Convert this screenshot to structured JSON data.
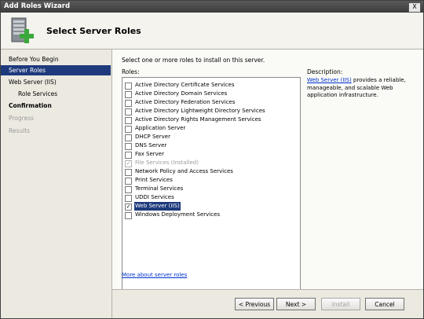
{
  "window": {
    "title": "Add Roles Wizard",
    "close_glyph": "X"
  },
  "header": {
    "title": "Select Server Roles",
    "icon": "server-add-icon"
  },
  "nav": [
    {
      "label": "Before You Begin",
      "state": "normal"
    },
    {
      "label": "Server Roles",
      "state": "active"
    },
    {
      "label": "Web Server (IIS)",
      "state": "normal"
    },
    {
      "label": "Role Services",
      "state": "sub"
    },
    {
      "label": "Confirmation",
      "state": "bold"
    },
    {
      "label": "Progress",
      "state": "disabled"
    },
    {
      "label": "Results",
      "state": "disabled"
    }
  ],
  "main": {
    "instruction": "Select one or more roles to install on this server.",
    "roles_label": "Roles:",
    "roles": [
      {
        "label": "Active Directory Certificate Services",
        "checked": false,
        "disabled": false,
        "selected": false
      },
      {
        "label": "Active Directory Domain Services",
        "checked": false,
        "disabled": false,
        "selected": false
      },
      {
        "label": "Active Directory Federation Services",
        "checked": false,
        "disabled": false,
        "selected": false
      },
      {
        "label": "Active Directory Lightweight Directory Services",
        "checked": false,
        "disabled": false,
        "selected": false
      },
      {
        "label": "Active Directory Rights Management Services",
        "checked": false,
        "disabled": false,
        "selected": false
      },
      {
        "label": "Application Server",
        "checked": false,
        "disabled": false,
        "selected": false
      },
      {
        "label": "DHCP Server",
        "checked": false,
        "disabled": false,
        "selected": false
      },
      {
        "label": "DNS Server",
        "checked": false,
        "disabled": false,
        "selected": false
      },
      {
        "label": "Fax Server",
        "checked": false,
        "disabled": false,
        "selected": false
      },
      {
        "label": "File Services  (Installed)",
        "checked": true,
        "disabled": true,
        "selected": false
      },
      {
        "label": "Network Policy and Access Services",
        "checked": false,
        "disabled": false,
        "selected": false
      },
      {
        "label": "Print Services",
        "checked": false,
        "disabled": false,
        "selected": false
      },
      {
        "label": "Terminal Services",
        "checked": false,
        "disabled": false,
        "selected": false
      },
      {
        "label": "UDDI Services",
        "checked": false,
        "disabled": false,
        "selected": false
      },
      {
        "label": "Web Server (IIS)",
        "checked": true,
        "disabled": false,
        "selected": true
      },
      {
        "label": "Windows Deployment Services",
        "checked": false,
        "disabled": false,
        "selected": false
      }
    ],
    "description_label": "Description:",
    "description_link": "Web Server (IIS)",
    "description_text": " provides a reliable, manageable, and scalable Web application infrastructure.",
    "more_link": "More about server roles"
  },
  "footer": {
    "previous": "< Previous",
    "next": "Next >",
    "install": "Install",
    "cancel": "Cancel"
  },
  "colors": {
    "selection": "#1e3a7d",
    "link": "#0033cc"
  }
}
